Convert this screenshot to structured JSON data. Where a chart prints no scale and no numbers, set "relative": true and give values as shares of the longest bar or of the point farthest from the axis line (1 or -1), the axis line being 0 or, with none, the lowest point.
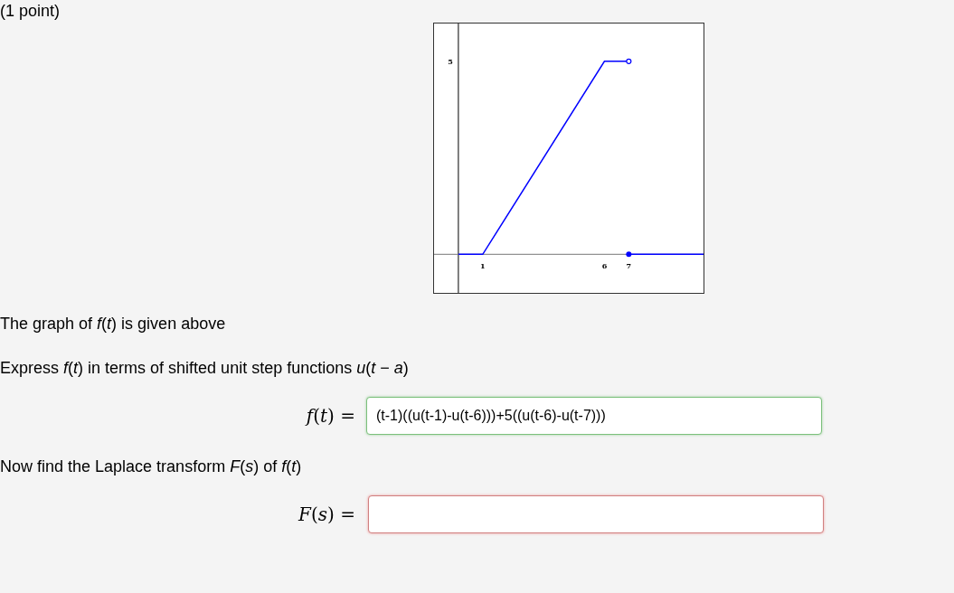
{
  "points_label": "(1 point)",
  "graph": {
    "chart_data": {
      "type": "line",
      "relative": true,
      "x": [
        0,
        1,
        6,
        7,
        10.07
      ],
      "xlim": [
        -1,
        10.07
      ],
      "xticks": [
        1,
        6,
        7
      ],
      "series": [
        {
          "color": "#0000ff",
          "values": [
            0,
            0,
            1,
            1,
            null
          ]
        },
        {
          "color": "#0000ff",
          "values": [
            null,
            null,
            null,
            0,
            0
          ]
        }
      ],
      "annotations": [
        "5"
      ]
    }
  },
  "sentences": [
    "The graph of *f*(*t*) is given above",
    "Express *f*(*t*) in terms of shifted unit step functions *u*(*t* − *a*)"
  ],
  "answer_1": {
    "label": "*f*(*t*) =",
    "value": "(t-1)((u(t-1)-u(t-6)))+5((u(t-6)-u(t-7)))",
    "correct": true
  },
  "sentence_3": "Now find the Laplace transform *F*(*s*) of *f*(*t*)",
  "answer_2": {
    "label": "*F*(*s*) =",
    "correct": false
  }
}
